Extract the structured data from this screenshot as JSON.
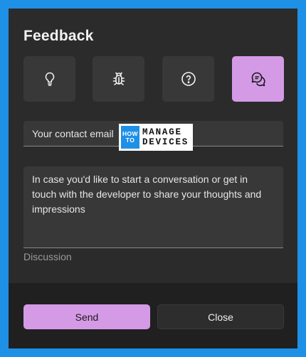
{
  "dialog": {
    "title": "Feedback",
    "feedback_types": [
      {
        "icon": "lightbulb-icon",
        "selected": false
      },
      {
        "icon": "bug-icon",
        "selected": false
      },
      {
        "icon": "question-icon",
        "selected": false
      },
      {
        "icon": "chat-bubbles-icon",
        "selected": true
      }
    ],
    "email": {
      "placeholder": "Your contact email",
      "value": ""
    },
    "discussion": {
      "placeholder": "In case you'd like to start a conversation or get in touch with the developer to share your thoughts and impressions",
      "value": "",
      "helper_label": "Discussion"
    },
    "buttons": {
      "send_label": "Send",
      "close_label": "Close"
    },
    "colors": {
      "accent": "#d59ae6",
      "background": "#2b2b2b",
      "frame": "#1e90e6"
    }
  },
  "watermark": {
    "left_top": "HOW",
    "left_bottom": "TO",
    "right_top": "MANAGE",
    "right_bottom": "DEVICES"
  }
}
